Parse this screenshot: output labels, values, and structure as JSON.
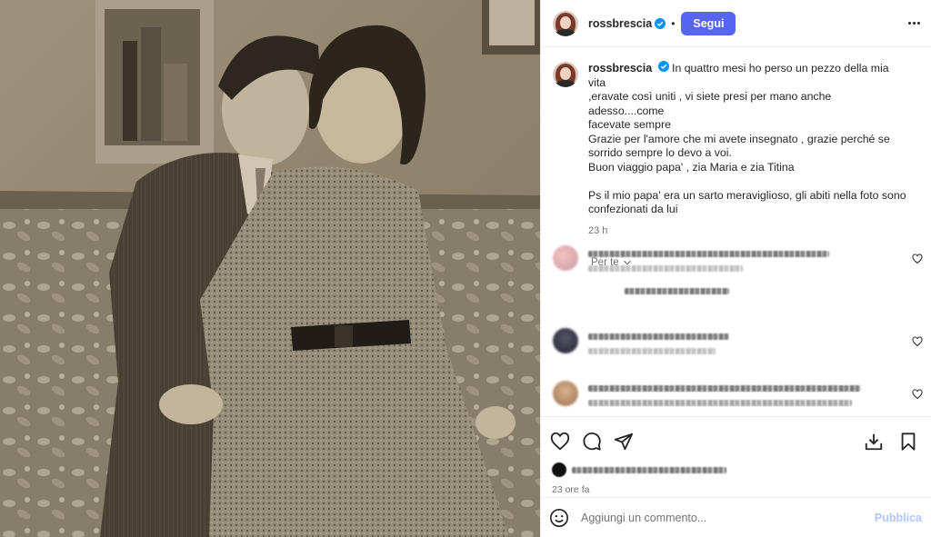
{
  "post": {
    "username": "rossbrescia",
    "separator": "•",
    "follow_label": "Segui",
    "caption_lines": [
      "In quattro mesi ho perso un pezzo della mia vita",
      ",eravate così uniti , vi siete presi per mano anche adesso....come",
      "facevate sempre",
      "Grazie per l'amore che mi avete insegnato , grazie perché se",
      "sorrido sempre lo devo a voi.",
      "Buon viaggio papa' , zia Maria e zia Titina",
      "",
      "Ps il mio papa' era un sarto meraviglioso, gli abiti nella foto sono",
      "confezionati da lui"
    ],
    "caption_time": "23 h",
    "for_you_label": "Per te",
    "posted_ago": "23 ore fa"
  },
  "comment_box": {
    "placeholder": "Aggiungi un commento...",
    "publish_label": "Pubblica"
  },
  "icons": {
    "verified": "verified-badge-icon",
    "more": "more-options-icon",
    "like": "heart-icon",
    "comment": "comment-icon",
    "share": "share-icon",
    "save": "bookmark-icon",
    "emoji": "emoji-icon",
    "chevron": "chevron-down-icon"
  },
  "colors": {
    "accent": "#5865f2",
    "verified": "#0095f6",
    "muted": "#737373"
  }
}
